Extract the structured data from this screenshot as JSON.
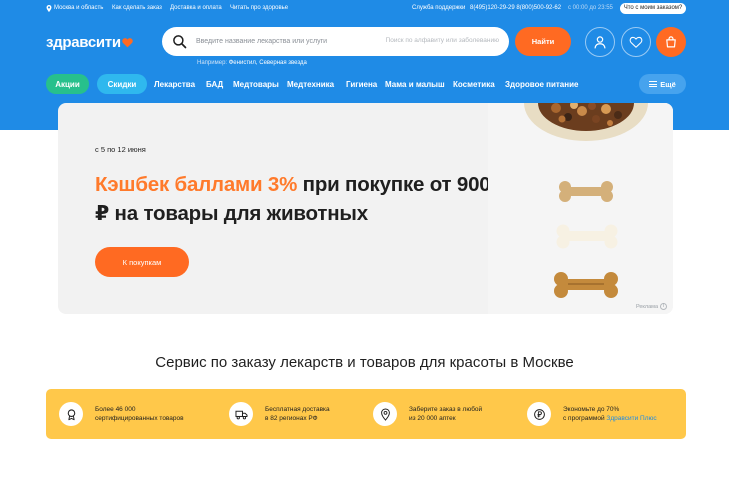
{
  "utility_bar": {
    "region": "Москва и область",
    "links": [
      "Как сделать заказ",
      "Доставка и оплата",
      "Читать про здоровье"
    ],
    "support_label": "Служба поддержки",
    "phones": "8(495)120-29-29  8(800)500-92-62",
    "hours": "с 00:00 до 23:55",
    "order_status_button": "Что с моим заказом?"
  },
  "header": {
    "logo_text": "здравсити",
    "search": {
      "placeholder": "Введите название лекарства или услуги",
      "value": "",
      "hint": "Поиск по алфавиту или заболеванию"
    },
    "search_button": "Найти",
    "example_label": "Например:",
    "example_values": "Фенистил, Северная звезда",
    "icons": [
      "user-icon",
      "heart-icon",
      "cart-icon"
    ]
  },
  "categories": {
    "promo_actions": "Акции",
    "promo_discounts": "Скидки",
    "items": [
      "Лекарства",
      "БАД",
      "Медтовары",
      "Медтехника",
      "Гигиена",
      "Мама и малыш",
      "Косметика",
      "Здоровое питание"
    ],
    "more_button": "Ещё"
  },
  "banner": {
    "dates": "с 5 по 12 июня",
    "title_accent": "Кэшбек баллами 3%",
    "title_rest": " при покупке от 900 ₽ на товары для животных",
    "cta": "К покупкам",
    "ad_label": "Реклама"
  },
  "service": {
    "title": "Сервис по заказу лекарств и товаров для красоты в Москве"
  },
  "features": [
    {
      "icon": "medal-icon",
      "line1": "Более 46 000",
      "line2": "сертифицированных товаров",
      "link": ""
    },
    {
      "icon": "truck-icon",
      "line1": "Бесплатная доставка",
      "line2": "в 82 регионах РФ",
      "link": ""
    },
    {
      "icon": "map-pin-icon",
      "line1": "Заберите заказ в любой",
      "line2": "из 20 000 аптек",
      "link": ""
    },
    {
      "icon": "ruble-coin-icon",
      "line1": "Экономьте до 70%",
      "line2": "с программой ",
      "link": "Здравсити Плюс"
    }
  ],
  "colors": {
    "brand_blue": "#1f8be6",
    "accent_orange": "#ff6a22",
    "promo_green": "#27c08c",
    "promo_cyan": "#2fb8ee",
    "features_yellow": "#ffc84a",
    "banner_bg": "#f2f2f2"
  }
}
